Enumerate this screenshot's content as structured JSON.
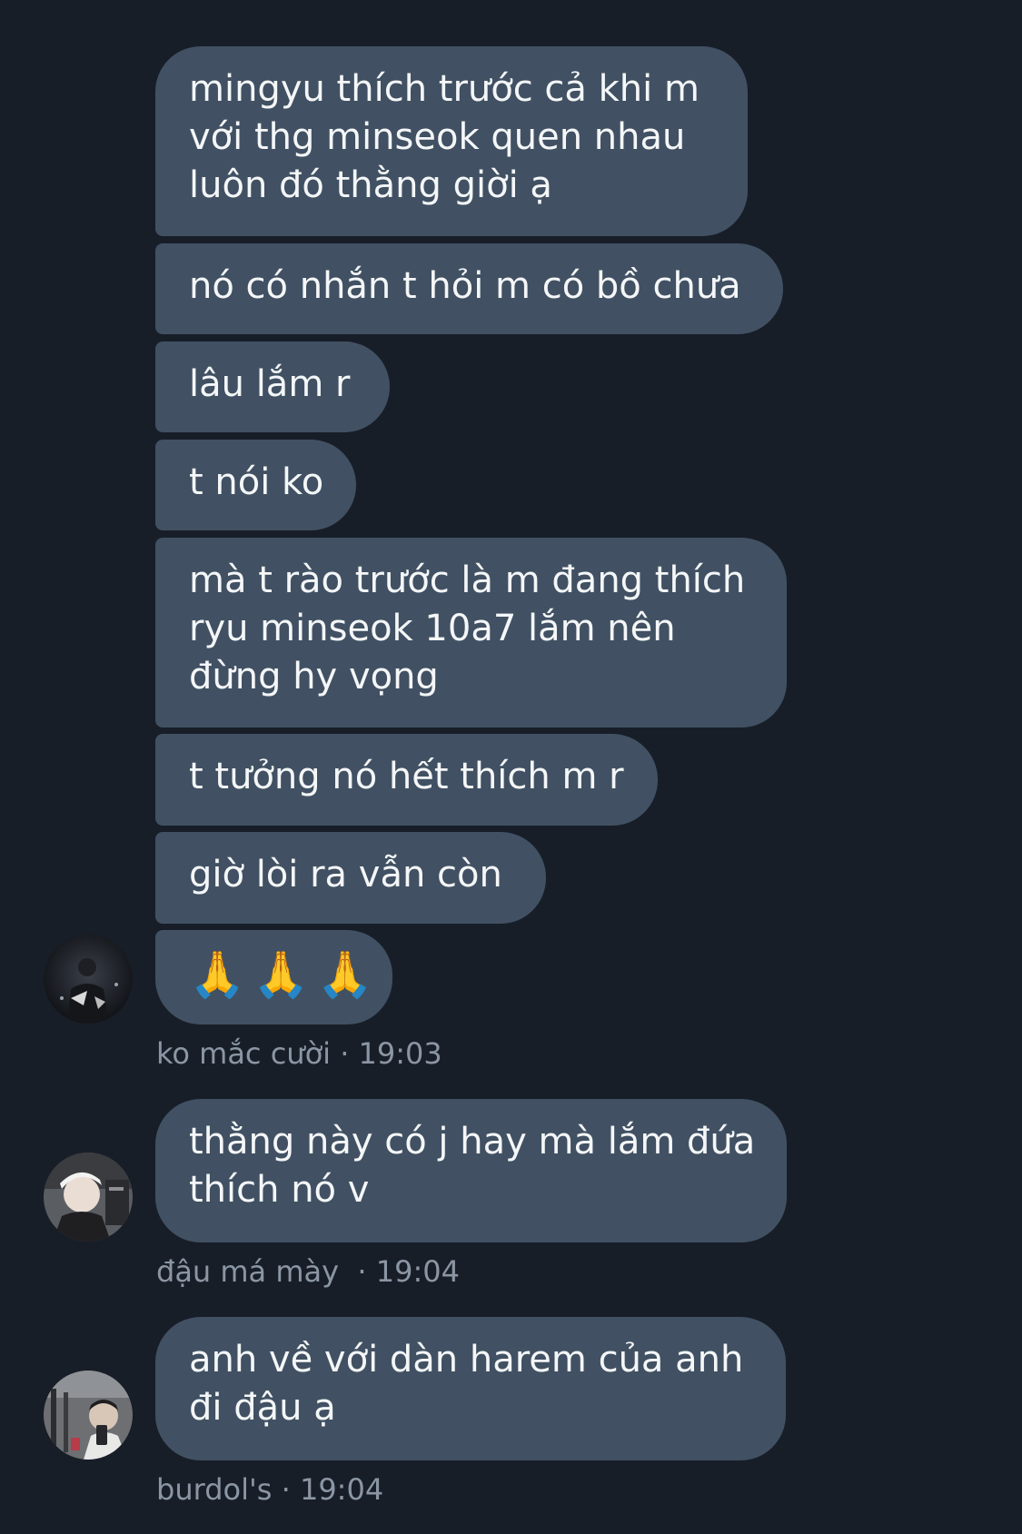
{
  "thread": {
    "groups": [
      {
        "messages": [
          {
            "lines": [
              "mingyu thích trước cả khi m",
              "với thg minseok quen nhau",
              "luôn đó thằng giời ạ"
            ]
          },
          {
            "lines": [
              "nó có nhắn t hỏi m có bồ chưa"
            ]
          },
          {
            "lines": [
              "lâu lắm r"
            ]
          },
          {
            "lines": [
              "t nói ko"
            ]
          },
          {
            "lines": [
              "mà t rào trước là m đang thích",
              "ryu minseok 10a7 lắm nên",
              "đừng hy vọng"
            ]
          },
          {
            "lines": [
              "t tưởng nó hết thích m r"
            ]
          },
          {
            "lines": [
              "giờ lòi ra vẫn còn"
            ]
          },
          {
            "emoji": "🙏🙏🙏",
            "emoji_name": "folded-hands-icon"
          }
        ],
        "sender": "ko mắc cười",
        "time": "19:03",
        "meta": "ko mắc cười · 19:03"
      },
      {
        "messages": [
          {
            "lines": [
              "thằng này có j hay mà lắm đứa",
              "thích nó v"
            ]
          }
        ],
        "sender": "đậu má mày",
        "time": "19:04",
        "meta": "đậu má mày  · 19:04"
      },
      {
        "messages": [
          {
            "lines": [
              "anh về với dàn harem của anh",
              "đi đậu ạ"
            ]
          }
        ],
        "sender": "burdol's",
        "time": "19:04",
        "meta": "burdol's · 19:04"
      }
    ]
  },
  "colors": {
    "background": "#181e28",
    "bubble": "#415163",
    "bubble_text": "#f4f6f8",
    "meta_text": "#8b96a4"
  }
}
